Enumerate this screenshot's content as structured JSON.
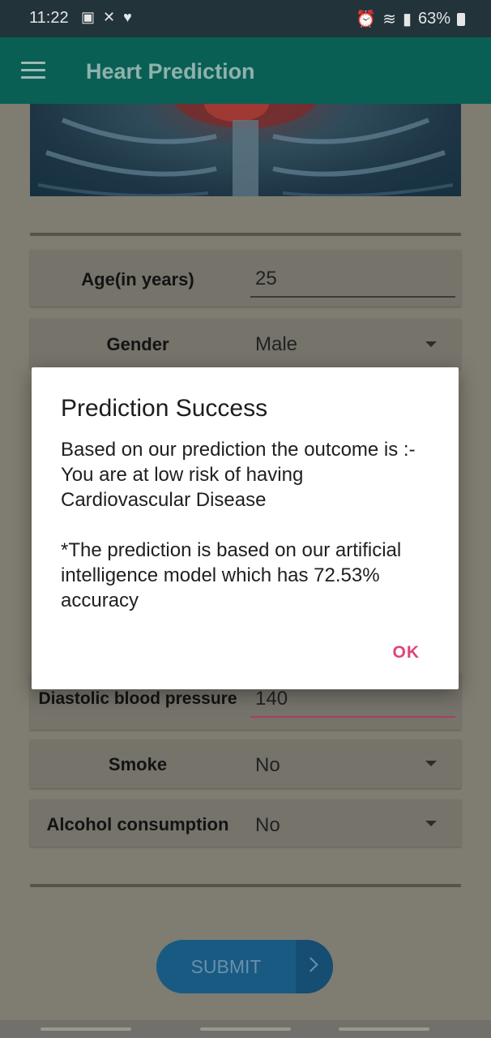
{
  "status_bar": {
    "time": "11:22",
    "battery": "63%",
    "icons_left": [
      "gallery-icon",
      "missed-call-icon",
      "health-icon"
    ],
    "icons_right": [
      "alarm-icon",
      "wifi-icon",
      "signal-icon",
      "battery-icon"
    ]
  },
  "app_bar": {
    "title": "Heart Prediction"
  },
  "form": {
    "age": {
      "label": "Age(in years)",
      "value": "25"
    },
    "gender": {
      "label": "Gender",
      "value": "Male"
    },
    "diastolic": {
      "label": "Diastolic blood pressure",
      "value": "140"
    },
    "smoke": {
      "label": "Smoke",
      "value": "No"
    },
    "alcohol": {
      "label": "Alcohol consumption",
      "value": "No"
    },
    "submit_label": "SUBMIT"
  },
  "dialog": {
    "title": "Prediction Success",
    "message": "Based on our prediction the outcome is :- You are at low risk of having Cardiovascular Disease\n\n*The prediction is based on our artificial intelligence model which has 72.53% accuracy",
    "ok_label": "OK"
  },
  "colors": {
    "app_bar": "#0a5f55",
    "accent": "#e0447a",
    "submit_button": "#195a83"
  }
}
